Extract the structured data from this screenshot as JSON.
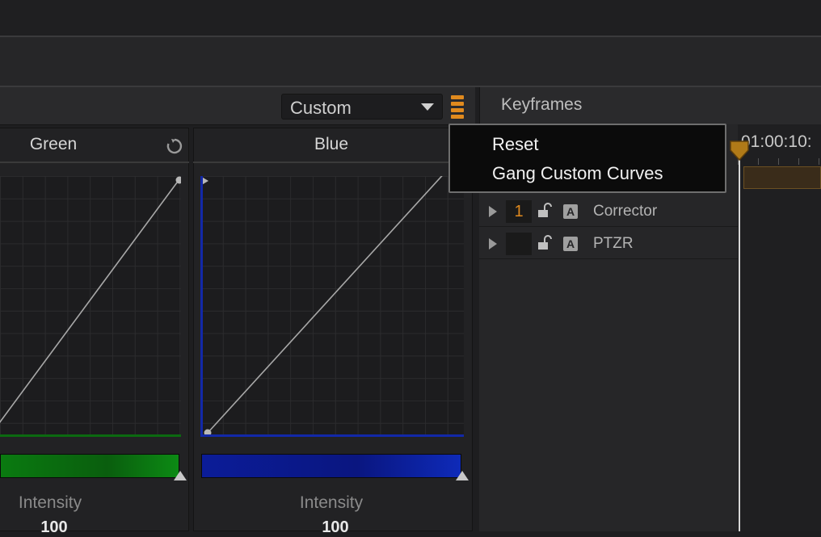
{
  "header": {
    "mode_dropdown": {
      "value": "Custom"
    },
    "keyframes_title": "Keyframes"
  },
  "panels": [
    {
      "title": "Green",
      "channel_color": "#0c7a12",
      "intensity_label": "Intensity",
      "intensity_value": "100"
    },
    {
      "title": "Blue",
      "channel_color": "#0b1fa8",
      "intensity_label": "Intensity",
      "intensity_value": "100"
    }
  ],
  "popup_menu": {
    "items": [
      "Reset",
      "Gang Custom Curves"
    ]
  },
  "keyframes": {
    "timecode": "01:00:10:",
    "tracks": [
      {
        "number": "1",
        "label": "Corrector"
      },
      {
        "number": "",
        "label": "PTZR"
      }
    ]
  },
  "colors": {
    "accent": "#e08a1e",
    "background": "#1e1e20"
  },
  "icons": [
    "reset-icon",
    "menu-icon",
    "chevron-down-icon",
    "expand-triangle-icon",
    "unlock-icon",
    "auto-badge-icon",
    "playhead-icon"
  ]
}
